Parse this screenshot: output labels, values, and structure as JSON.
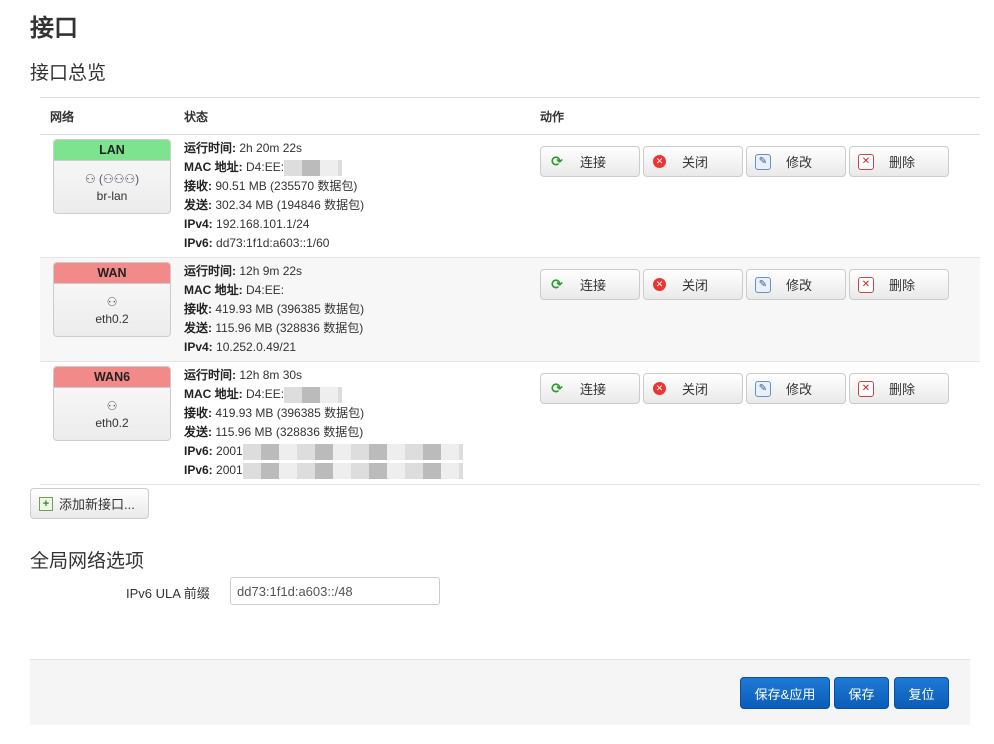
{
  "page_title": "接口",
  "section_title": "接口总览",
  "table": {
    "headers": {
      "network": "网络",
      "status": "状态",
      "actions": "动作"
    },
    "rows": [
      {
        "name": "LAN",
        "color": "#7de38f",
        "icons": "⚇ (⚇⚇⚇)",
        "device": "br-lan",
        "uptime_label": "运行时间:",
        "uptime": "2h 20m 22s",
        "mac_label": "MAC 地址:",
        "mac": "D4:EE:",
        "rx_label": "接收:",
        "rx": "90.51 MB (235570 数据包)",
        "tx_label": "发送:",
        "tx": "302.34 MB (194846 数据包)",
        "ip1_label": "IPv4:",
        "ip1": "192.168.101.1/24",
        "ip2_label": "IPv6:",
        "ip2": "dd73:1f1d:a603::1/60"
      },
      {
        "name": "WAN",
        "color": "#f28a8a",
        "icons": "⚇",
        "device": "eth0.2",
        "uptime_label": "运行时间:",
        "uptime": "12h 9m 22s",
        "mac_label": "MAC 地址:",
        "mac": "D4:EE:",
        "rx_label": "接收:",
        "rx": "419.93 MB (396385 数据包)",
        "tx_label": "发送:",
        "tx": "115.96 MB (328836 数据包)",
        "ip1_label": "IPv4:",
        "ip1": "10.252.0.49/21"
      },
      {
        "name": "WAN6",
        "color": "#f28a8a",
        "icons": "⚇",
        "device": "eth0.2",
        "uptime_label": "运行时间:",
        "uptime": "12h 8m 30s",
        "mac_label": "MAC 地址:",
        "mac": "D4:EE:",
        "rx_label": "接收:",
        "rx": "419.93 MB (396385 数据包)",
        "tx_label": "发送:",
        "tx": "115.96 MB (328836 数据包)",
        "ip1_label": "IPv6:",
        "ip1": "2001",
        "ip2_label": "IPv6:",
        "ip2": "2001"
      }
    ],
    "actions": {
      "connect": "连接",
      "stop": "关闭",
      "edit": "修改",
      "delete": "删除"
    }
  },
  "add_button": "添加新接口...",
  "global_title": "全局网络选项",
  "ula": {
    "label": "IPv6 ULA 前缀",
    "value": "dd73:1f1d:a603::/48"
  },
  "footer": {
    "save_apply": "保存&应用",
    "save": "保存",
    "reset": "复位"
  }
}
